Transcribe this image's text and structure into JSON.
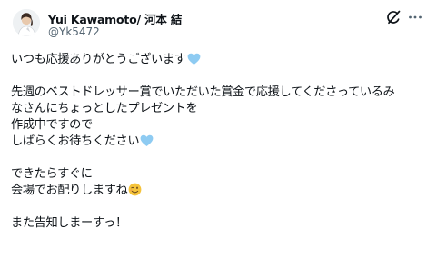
{
  "author": {
    "name": "Yui Kawamoto/ 河本 結",
    "handle": "@Yk5472"
  },
  "icons": {
    "avatar": "avatar",
    "grok": "grok-slash-icon",
    "more": "more-dots-icon",
    "heart": "light-blue-heart-emoji",
    "wink": "winking-face-emoji"
  },
  "colors": {
    "text": "#0f1419",
    "secondary": "#536471",
    "heart": "#8ecbf2",
    "wink_face": "#f5c33b"
  },
  "post": {
    "line1": "いつも応援ありがとうございます",
    "line2": "先週のベストドレッサー賞でいただいた賞金で応援してくださっているみ",
    "line3": "なさんにちょっとしたプレゼントを",
    "line4": "作成中ですので",
    "line5": "しばらくお待ちください",
    "line6": "できたらすぐに",
    "line7": "会場でお配りしますね",
    "line8": "また告知しまーすっ！"
  }
}
